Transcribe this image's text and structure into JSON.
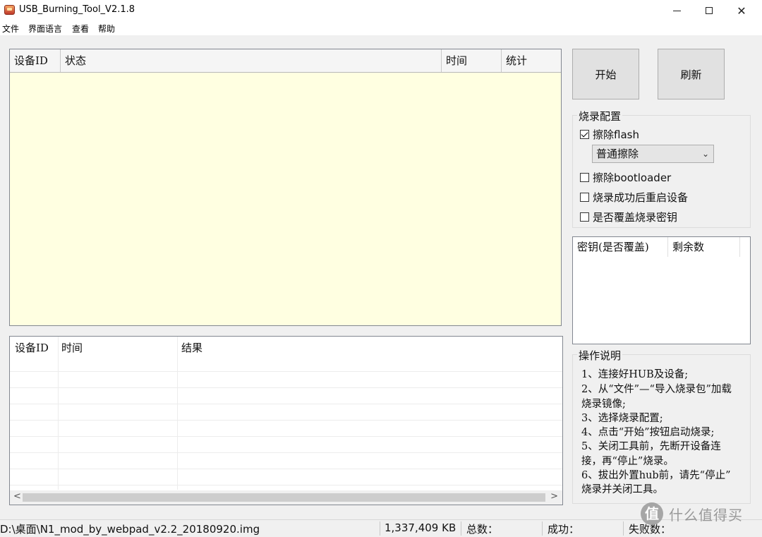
{
  "window": {
    "title": "USB_Burning_Tool_V2.1.8",
    "minimize": "",
    "maximize": "",
    "close": "✕"
  },
  "menu": [
    "文件",
    "界面语言",
    "查看",
    "帮助"
  ],
  "device_table": {
    "columns": [
      "设备ID",
      "状态",
      "时间",
      "统计"
    ],
    "background": "#ffffe1"
  },
  "result_table": {
    "columns": [
      "设备ID",
      "时间",
      "结果"
    ],
    "scroll_left": "<",
    "scroll_right": ">"
  },
  "buttons": {
    "start": "开始",
    "refresh": "刷新"
  },
  "burn_config": {
    "title": "烧录配置",
    "erase_flash": {
      "label": "擦除flash",
      "checked": true
    },
    "erase_mode": "普通擦除",
    "erase_bootloader": {
      "label": "擦除bootloader",
      "checked": false
    },
    "reboot_after": {
      "label": "烧录成功后重启设备",
      "checked": false
    },
    "overwrite_key": {
      "label": "是否覆盖烧录密钥",
      "checked": false
    }
  },
  "key_list": {
    "columns": [
      "密钥(是否覆盖)",
      "剩余数"
    ]
  },
  "instructions": {
    "title": "操作说明",
    "lines": [
      "1、连接好HUB及设备;",
      "2、从“文件”—“导入烧录包”加载",
      "烧录镜像;",
      "3、选择烧录配置;",
      "4、点击“开始”按钮启动烧录;",
      "5、关闭工具前，先断开设备连",
      "接，再“停止”烧录。",
      "6、拔出外置hub前，请先“停止”",
      "烧录并关闭工具。"
    ]
  },
  "status_bar": {
    "path": "D:\\桌面\\N1_mod_by_webpad_v2.2_20180920.img",
    "size": "1,337,409 KB",
    "total": "总数：",
    "success": "成功：",
    "failed": "失败数："
  },
  "watermark": {
    "icon": "值",
    "text": "什么值得买"
  }
}
